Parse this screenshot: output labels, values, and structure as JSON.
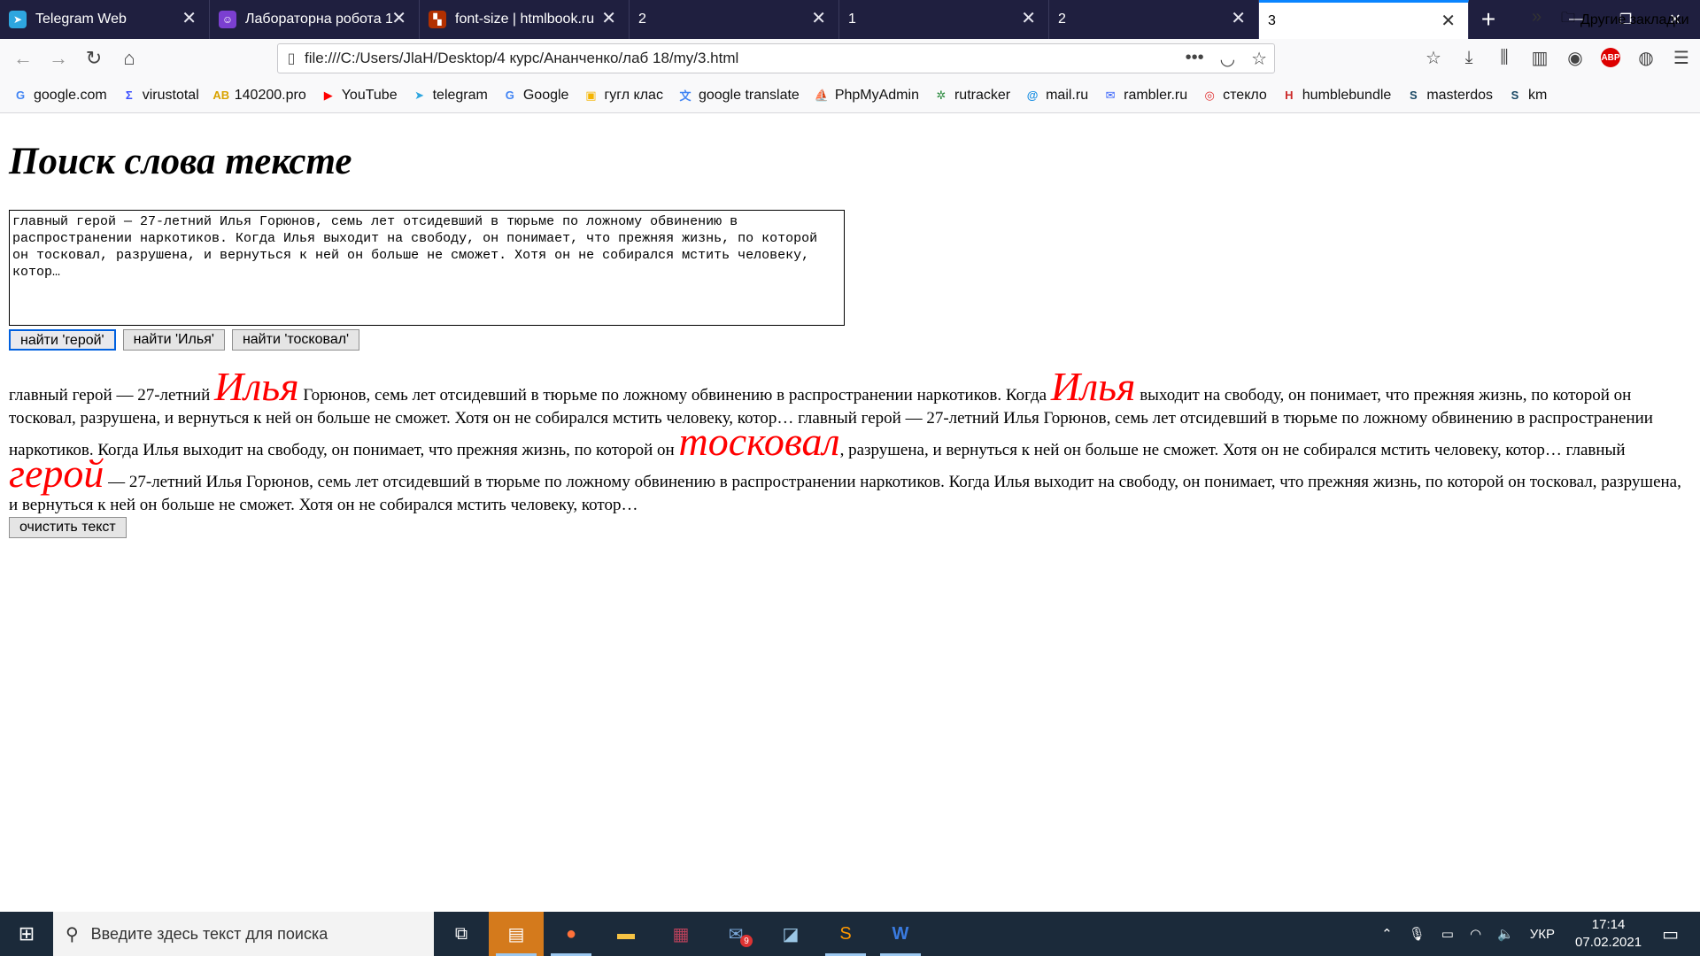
{
  "tabs": [
    {
      "title": "Telegram Web",
      "fav_color": "#2ea6df",
      "icon": "telegram-icon",
      "glyph": "➤"
    },
    {
      "title": "Лабораторна робота 1",
      "fav_color": "#7b3fd1",
      "icon": "classroom-icon",
      "glyph": "☺"
    },
    {
      "title": "font-size | htmlbook.ru",
      "fav_color": "#b23000",
      "icon": "htmlbook-icon",
      "glyph": "▚"
    },
    {
      "title": "2",
      "fav_color": "",
      "icon": "",
      "glyph": ""
    },
    {
      "title": "1",
      "fav_color": "",
      "icon": "",
      "glyph": ""
    },
    {
      "title": "2",
      "fav_color": "",
      "icon": "",
      "glyph": ""
    },
    {
      "title": "3",
      "fav_color": "",
      "icon": "",
      "glyph": ""
    }
  ],
  "nav": {
    "url": "file:///C:/Users/JlaH/Desktop/4 курс/Ананченко/лаб 18/my/3.html"
  },
  "bookmarks": [
    {
      "label": "google.com",
      "icon": "google-icon",
      "glyph": "G",
      "color": "#4285f4"
    },
    {
      "label": "virustotal",
      "icon": "virustotal-icon",
      "glyph": "Σ",
      "color": "#394eff"
    },
    {
      "label": "140200.pro",
      "icon": "ab-icon",
      "glyph": "AB",
      "color": "#d9a300"
    },
    {
      "label": "YouTube",
      "icon": "youtube-icon",
      "glyph": "▶",
      "color": "#ff0000"
    },
    {
      "label": "telegram",
      "icon": "telegram-icon",
      "glyph": "➤",
      "color": "#2ea6df"
    },
    {
      "label": "Google",
      "icon": "google-icon",
      "glyph": "G",
      "color": "#4285f4"
    },
    {
      "label": "гугл клас",
      "icon": "classroom-icon",
      "glyph": "▣",
      "color": "#f4b400"
    },
    {
      "label": "google translate",
      "icon": "translate-icon",
      "glyph": "文",
      "color": "#4285f4"
    },
    {
      "label": "PhpMyAdmin",
      "icon": "phpmyadmin-icon",
      "glyph": "⛵",
      "color": "#f29111"
    },
    {
      "label": "rutracker",
      "icon": "rutracker-icon",
      "glyph": "✲",
      "color": "#2b8a3e"
    },
    {
      "label": "mail.ru",
      "icon": "mail-ru-icon",
      "glyph": "@",
      "color": "#168de2"
    },
    {
      "label": "rambler.ru",
      "icon": "rambler-icon",
      "glyph": "✉",
      "color": "#315efb"
    },
    {
      "label": "стекло",
      "icon": "steklo-icon",
      "glyph": "◎",
      "color": "#e03131"
    },
    {
      "label": "humblebundle",
      "icon": "humble-icon",
      "glyph": "H",
      "color": "#cc2929"
    },
    {
      "label": "masterdos",
      "icon": "masterdos-icon",
      "glyph": "S",
      "color": "#1b4965"
    },
    {
      "label": "km",
      "icon": "km-icon",
      "glyph": "S",
      "color": "#1b4965"
    }
  ],
  "bookmarks_more": "Другие закладки",
  "page": {
    "title": "Поиск слова тексте",
    "source_text": "главный герой — 27-летний Илья Горюнов, семь лет отсидевший в тюрьме по ложному обвинению в распространении наркотиков. Когда Илья выходит на свободу, он понимает, что прежняя жизнь, по которой он тосковал, разрушена, и вернуться к ней он больше не сможет. Хотя он не собирался мстить человеку, котор…",
    "buttons": [
      "найти 'герой'",
      "найти 'Илья'",
      "найти 'тосковал'"
    ],
    "result_segments": [
      {
        "text": "главный герой — 27-летний ",
        "hl": false
      },
      {
        "text": "Илья",
        "hl": true
      },
      {
        "text": " Горюнов, семь лет отсидевший в тюрьме по ложному обвинению в распространении наркотиков. Когда ",
        "hl": false
      },
      {
        "text": "Илья",
        "hl": true
      },
      {
        "text": " выходит на свободу, он понимает, что прежняя жизнь, по которой он тосковал, разрушена, и вернуться к ней он больше не сможет. Хотя он не собирался мстить человеку, котор… главный герой — 27-летний Илья Горюнов, семь лет отсидевший в тюрьме по ложному обвинению в распространении наркотиков. Когда Илья выходит на свободу, он понимает, что прежняя жизнь, по которой он ",
        "hl": false
      },
      {
        "text": "тосковал",
        "hl": true
      },
      {
        "text": ", разрушена, и вернуться к ней он больше не сможет. Хотя он не собирался мстить человеку, котор… главный ",
        "hl": false
      },
      {
        "text": "герой",
        "hl": true
      },
      {
        "text": " — 27-летний Илья Горюнов, семь лет отсидевший в тюрьме по ложному обвинению в распространении наркотиков. Когда Илья выходит на свободу, он понимает, что прежняя жизнь, по которой он тосковал, разрушена, и вернуться к ней он больше не сможет. Хотя он не собирался мстить человеку, котор…",
        "hl": false
      }
    ],
    "clear_button": "очистить текст",
    "highlight_color": "#ff0000"
  },
  "taskbar": {
    "search_placeholder": "Введите здесь текст для поиска",
    "language": "УКР",
    "time": "17:14",
    "date": "07.02.2021",
    "mail_badge": "9"
  }
}
